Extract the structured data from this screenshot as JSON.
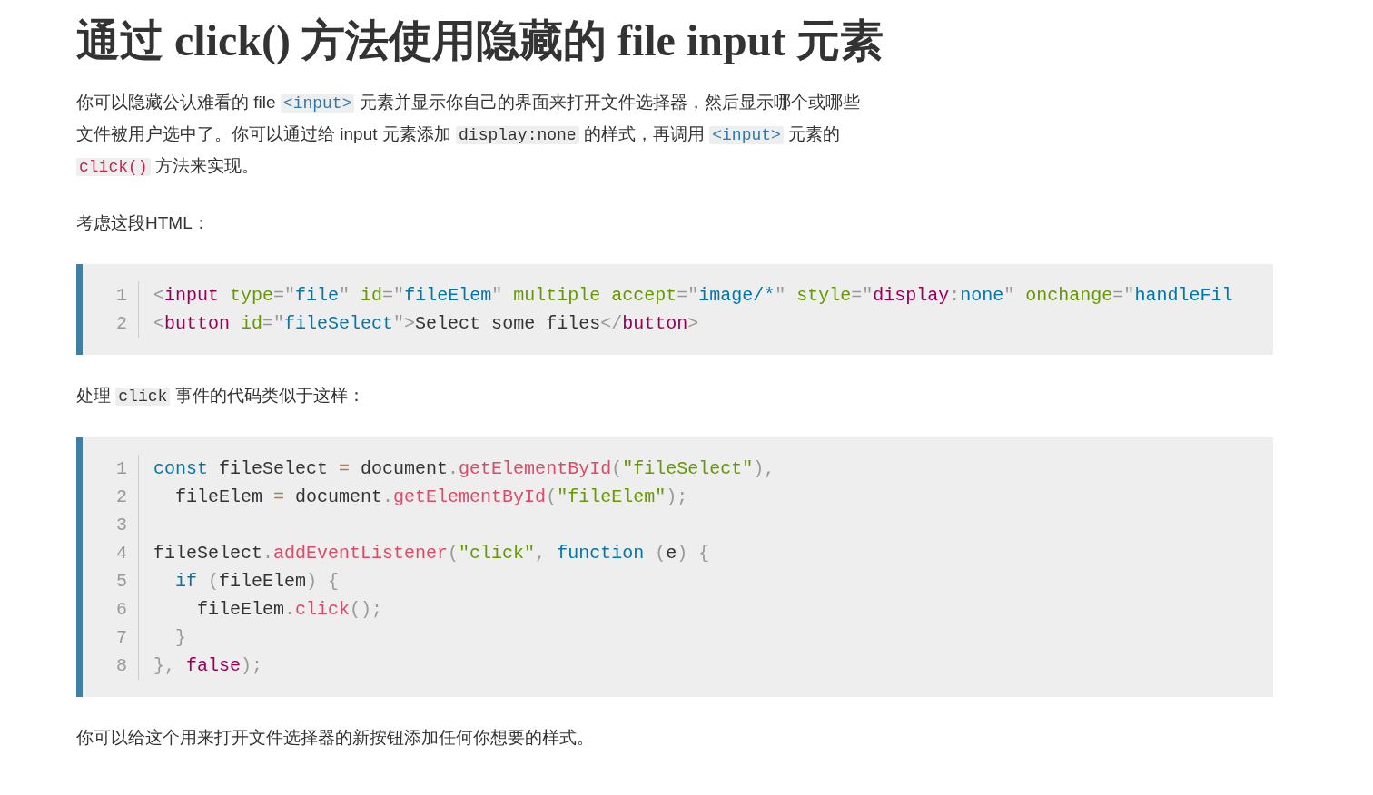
{
  "title": "通过 click() 方法使用隐藏的 file input 元素",
  "blocks": [
    {
      "kind": "paragraph",
      "parts": [
        {
          "kind": "text",
          "t": "你可以隐藏公认难看的 file "
        },
        {
          "kind": "tag",
          "t": "<input>"
        },
        {
          "kind": "text",
          "t": " 元素并显示你自己的界面来打开文件选择器，然后显示哪个或哪些文件被用户选中了。你可以通过给 input 元素添加 "
        },
        {
          "kind": "code",
          "t": "display:none"
        },
        {
          "kind": "text",
          "t": " 的样式，再调用 "
        },
        {
          "kind": "tag",
          "t": "<input>"
        },
        {
          "kind": "text",
          "t": " 元素的 "
        },
        {
          "kind": "call",
          "t": "click()"
        },
        {
          "kind": "text",
          "t": " 方法来实现。"
        }
      ]
    },
    {
      "kind": "paragraph",
      "parts": [
        {
          "kind": "text",
          "t": "考虑这段HTML："
        }
      ]
    },
    {
      "kind": "code",
      "lines": [
        {
          "n": "1",
          "tokens": [
            {
              "kind": "punct",
              "t": "<"
            },
            {
              "kind": "tag",
              "t": "input"
            },
            {
              "kind": "attr",
              "t": " type"
            },
            {
              "kind": "punct",
              "t": "=\""
            },
            {
              "kind": "value",
              "t": "file"
            },
            {
              "kind": "punct",
              "t": "\""
            },
            {
              "kind": "attr",
              "t": " id"
            },
            {
              "kind": "punct",
              "t": "=\""
            },
            {
              "kind": "value",
              "t": "fileElem"
            },
            {
              "kind": "punct",
              "t": "\""
            },
            {
              "kind": "attr",
              "t": " multiple accept"
            },
            {
              "kind": "punct",
              "t": "=\""
            },
            {
              "kind": "value",
              "t": "image/*"
            },
            {
              "kind": "punct",
              "t": "\""
            },
            {
              "kind": "attr",
              "t": " style"
            },
            {
              "kind": "punct",
              "t": "=\""
            },
            {
              "kind": "tag",
              "t": "display"
            },
            {
              "kind": "punct",
              "t": ":"
            },
            {
              "kind": "value",
              "t": "none"
            },
            {
              "kind": "punct",
              "t": "\""
            },
            {
              "kind": "attr",
              "t": " onchange"
            },
            {
              "kind": "punct",
              "t": "=\""
            },
            {
              "kind": "value",
              "t": "handleFil"
            }
          ]
        },
        {
          "n": "2",
          "tokens": [
            {
              "kind": "punct",
              "t": "<"
            },
            {
              "kind": "tag",
              "t": "button"
            },
            {
              "kind": "attr",
              "t": " id"
            },
            {
              "kind": "punct",
              "t": "=\""
            },
            {
              "kind": "value",
              "t": "fileSelect"
            },
            {
              "kind": "punct",
              "t": "\">"
            },
            {
              "kind": "plain",
              "t": "Select some files"
            },
            {
              "kind": "punct",
              "t": "</"
            },
            {
              "kind": "tag",
              "t": "button"
            },
            {
              "kind": "punct",
              "t": ">"
            }
          ]
        }
      ]
    },
    {
      "kind": "paragraph",
      "parts": [
        {
          "kind": "text",
          "t": "处理 "
        },
        {
          "kind": "code",
          "t": "click"
        },
        {
          "kind": "text",
          "t": " 事件的代码类似于这样："
        }
      ]
    },
    {
      "kind": "code",
      "lines": [
        {
          "n": "1",
          "tokens": [
            {
              "kind": "keyword",
              "t": "const"
            },
            {
              "kind": "plain",
              "t": " fileSelect "
            },
            {
              "kind": "op",
              "t": "="
            },
            {
              "kind": "plain",
              "t": " document"
            },
            {
              "kind": "punct",
              "t": "."
            },
            {
              "kind": "fn",
              "t": "getElementById"
            },
            {
              "kind": "punct",
              "t": "("
            },
            {
              "kind": "string",
              "t": "\"fileSelect\""
            },
            {
              "kind": "punct",
              "t": "),"
            }
          ]
        },
        {
          "n": "2",
          "tokens": [
            {
              "kind": "plain",
              "t": "  fileElem "
            },
            {
              "kind": "op",
              "t": "="
            },
            {
              "kind": "plain",
              "t": " document"
            },
            {
              "kind": "punct",
              "t": "."
            },
            {
              "kind": "fn",
              "t": "getElementById"
            },
            {
              "kind": "punct",
              "t": "("
            },
            {
              "kind": "string",
              "t": "\"fileElem\""
            },
            {
              "kind": "punct",
              "t": ");"
            }
          ]
        },
        {
          "n": "3"
        },
        {
          "n": "4",
          "tokens": [
            {
              "kind": "plain",
              "t": "fileSelect"
            },
            {
              "kind": "punct",
              "t": "."
            },
            {
              "kind": "fn",
              "t": "addEventListener"
            },
            {
              "kind": "punct",
              "t": "("
            },
            {
              "kind": "string",
              "t": "\"click\""
            },
            {
              "kind": "punct",
              "t": ", "
            },
            {
              "kind": "keyword",
              "t": "function"
            },
            {
              "kind": "punct",
              "t": " ("
            },
            {
              "kind": "plain",
              "t": "e"
            },
            {
              "kind": "punct",
              "t": ") {"
            }
          ]
        },
        {
          "n": "5",
          "tokens": [
            {
              "kind": "keyword",
              "t": "  if"
            },
            {
              "kind": "punct",
              "t": " ("
            },
            {
              "kind": "plain",
              "t": "fileElem"
            },
            {
              "kind": "punct",
              "t": ") {"
            }
          ]
        },
        {
          "n": "6",
          "tokens": [
            {
              "kind": "plain",
              "t": "    fileElem"
            },
            {
              "kind": "punct",
              "t": "."
            },
            {
              "kind": "fn",
              "t": "click"
            },
            {
              "kind": "punct",
              "t": "();"
            }
          ]
        },
        {
          "n": "7",
          "tokens": [
            {
              "kind": "punct",
              "t": "  }"
            }
          ]
        },
        {
          "n": "8",
          "tokens": [
            {
              "kind": "punct",
              "t": "}, "
            },
            {
              "kind": "tag",
              "t": "false"
            },
            {
              "kind": "punct",
              "t": ");"
            }
          ]
        }
      ]
    },
    {
      "kind": "paragraph",
      "parts": [
        {
          "kind": "text",
          "t": "你可以给这个用来打开文件选择器的新按钮添加任何你想要的样式。"
        }
      ]
    }
  ]
}
